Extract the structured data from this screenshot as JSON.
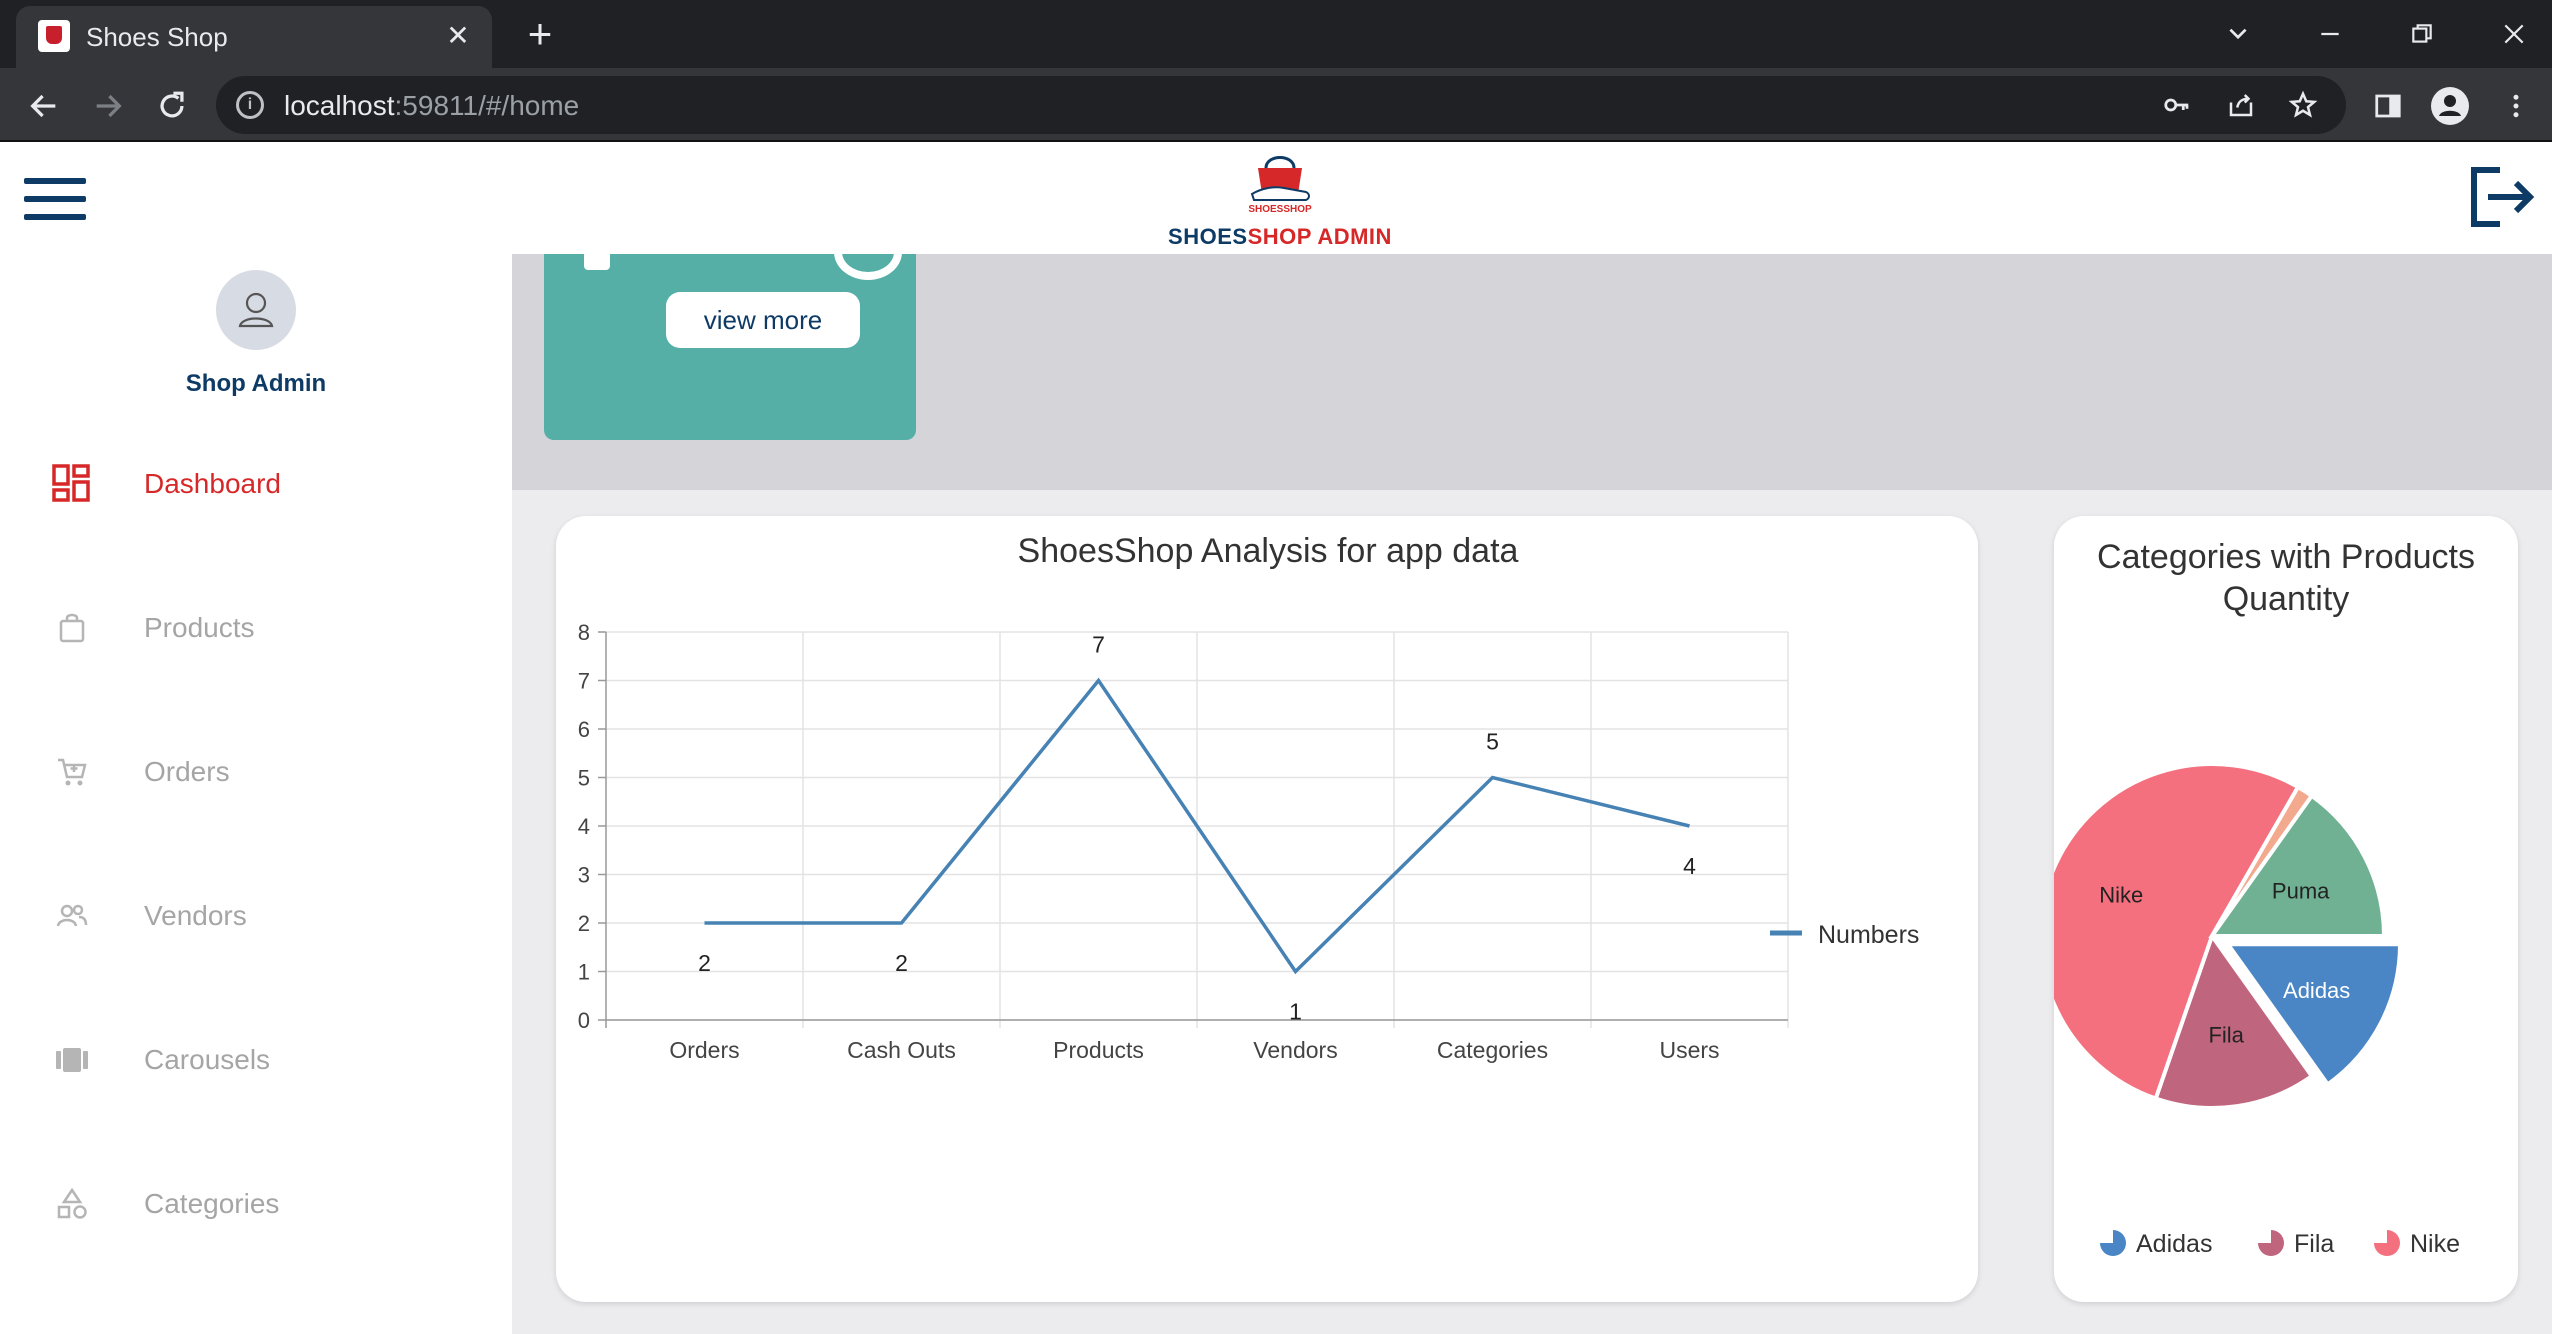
{
  "browser": {
    "tab_title": "Shoes Shop",
    "url_host": "localhost",
    "url_rest": ":59811/#/home"
  },
  "header": {
    "logo_small": "SHOESSHOP",
    "brand_part1": "SHOES",
    "brand_part2": "SHOP ADMIN"
  },
  "sidebar": {
    "user_name": "Shop Admin",
    "items": [
      {
        "label": "Dashboard",
        "icon": "dashboard-icon",
        "active": true
      },
      {
        "label": "Products",
        "icon": "shopping-bag-icon"
      },
      {
        "label": "Orders",
        "icon": "cart-icon"
      },
      {
        "label": "Vendors",
        "icon": "people-icon"
      },
      {
        "label": "Carousels",
        "icon": "carousel-icon"
      },
      {
        "label": "Categories",
        "icon": "categories-icon"
      }
    ]
  },
  "stat_card": {
    "button_label": "view more"
  },
  "colors": {
    "brand_blue": "#0d3b66",
    "brand_red": "#d62828",
    "teal": "#55afa7"
  },
  "chart_data": [
    {
      "type": "line",
      "title": "ShoesShop Analysis for app data",
      "categories": [
        "Orders",
        "Cash Outs",
        "Products",
        "Vendors",
        "Categories",
        "Users"
      ],
      "series": [
        {
          "name": "Numbers",
          "values": [
            2,
            2,
            7,
            1,
            5,
            4
          ],
          "color": "#4682b4"
        }
      ],
      "ylim": [
        0,
        8
      ],
      "yticks": [
        "0",
        "1",
        "2",
        "3",
        "4",
        "5",
        "6",
        "7",
        "8"
      ],
      "grid": true,
      "legend": "right"
    },
    {
      "type": "pie",
      "title_line1": "Categories with Products",
      "title_line2": "Quantity",
      "slices": [
        {
          "label": "Adidas",
          "color": "#4a86c5",
          "value": 4,
          "exploded": true
        },
        {
          "label": "Fila",
          "color": "#c0657e",
          "value": 4
        },
        {
          "label": "Nike",
          "color": "#f4707e",
          "value": 14
        },
        {
          "label": "Puma",
          "color": "#6fb192",
          "value": 4
        },
        {
          "label": "",
          "color": "#f3a98d",
          "value": 0.4
        }
      ],
      "legend": [
        "Adidas",
        "Fila",
        "Nike"
      ],
      "legend_position": "bottom"
    }
  ]
}
